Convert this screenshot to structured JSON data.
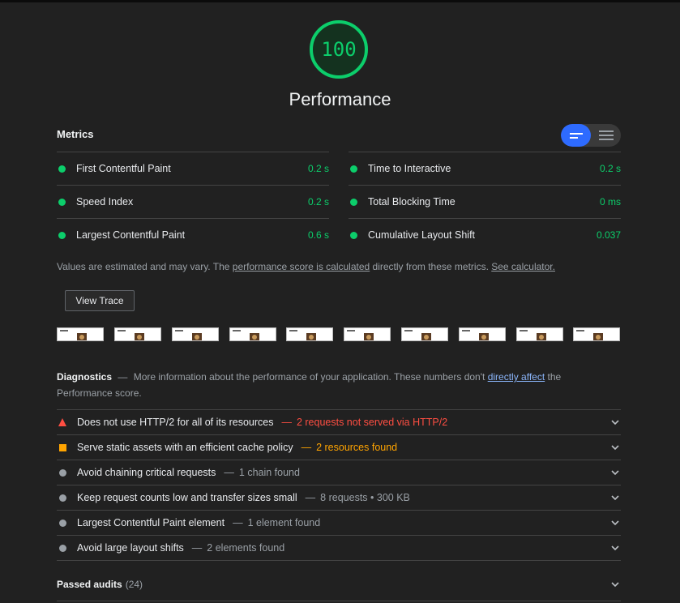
{
  "gauge": {
    "score": "100",
    "title": "Performance",
    "color": "#0cce6b"
  },
  "metrics": {
    "title": "Metrics",
    "toggle": {
      "active": "bar-view-icon",
      "inactive": "list-view-icon"
    },
    "left": [
      {
        "label": "First Contentful Paint",
        "value": "0.2 s"
      },
      {
        "label": "Speed Index",
        "value": "0.2 s"
      },
      {
        "label": "Largest Contentful Paint",
        "value": "0.6 s"
      }
    ],
    "right": [
      {
        "label": "Time to Interactive",
        "value": "0.2 s"
      },
      {
        "label": "Total Blocking Time",
        "value": "0 ms"
      },
      {
        "label": "Cumulative Layout Shift",
        "value": "0.037"
      }
    ],
    "note": {
      "prefix": "Values are estimated and may vary. The ",
      "link1": "performance score is calculated",
      "middle": " directly from these metrics.",
      "link2": "See calculator."
    }
  },
  "view_trace_label": "View Trace",
  "filmstrip_frames": 10,
  "diagnostics": {
    "title": "Diagnostics",
    "dash": "—",
    "text1": "More information about the performance of your application. These numbers don't ",
    "link": "directly affect",
    "text2": " the Performance score.",
    "items": [
      {
        "status": "fail",
        "icon": "triangle-icon",
        "title": "Does not use HTTP/2 for all of its resources",
        "detail": "2 requests not served via HTTP/2"
      },
      {
        "status": "average",
        "icon": "square-icon",
        "title": "Serve static assets with an efficient cache policy",
        "detail": "2 resources found"
      },
      {
        "status": "info",
        "icon": "circle-icon",
        "title": "Avoid chaining critical requests",
        "detail": "1 chain found"
      },
      {
        "status": "info",
        "icon": "circle-icon",
        "title": "Keep request counts low and transfer sizes small",
        "detail": "8 requests • 300 KB"
      },
      {
        "status": "info",
        "icon": "circle-icon",
        "title": "Largest Contentful Paint element",
        "detail": "1 element found"
      },
      {
        "status": "info",
        "icon": "circle-icon",
        "title": "Avoid large layout shifts",
        "detail": "2 elements found"
      }
    ]
  },
  "passed": {
    "label": "Passed audits",
    "count": "(24)"
  },
  "colors": {
    "pass": "#0cce6b",
    "fail": "#ff4e42",
    "average": "#ffa400",
    "info": "#9aa0a6",
    "accent": "#2e6bff"
  }
}
